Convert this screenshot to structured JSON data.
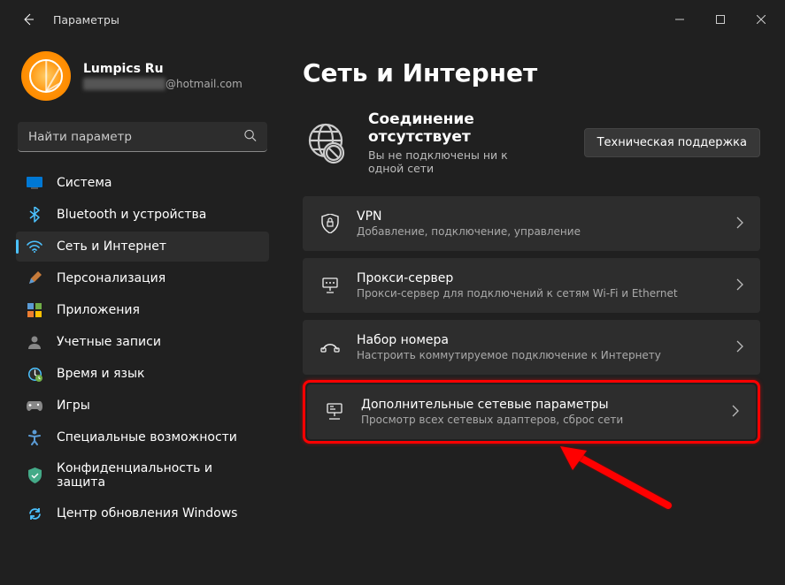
{
  "window": {
    "title": "Параметры"
  },
  "profile": {
    "name": "Lumpics Ru",
    "email_suffix": "@hotmail.com"
  },
  "search": {
    "placeholder": "Найти параметр"
  },
  "sidebar": {
    "items": [
      {
        "label": "Система",
        "icon": "system"
      },
      {
        "label": "Bluetooth и устройства",
        "icon": "bluetooth"
      },
      {
        "label": "Сеть и Интернет",
        "icon": "network",
        "active": true
      },
      {
        "label": "Персонализация",
        "icon": "personalize"
      },
      {
        "label": "Приложения",
        "icon": "apps"
      },
      {
        "label": "Учетные записи",
        "icon": "accounts"
      },
      {
        "label": "Время и язык",
        "icon": "time"
      },
      {
        "label": "Игры",
        "icon": "gaming"
      },
      {
        "label": "Специальные возможности",
        "icon": "accessibility"
      },
      {
        "label": "Конфиденциальность и защита",
        "icon": "privacy"
      },
      {
        "label": "Центр обновления Windows",
        "icon": "update"
      }
    ]
  },
  "page": {
    "title": "Сеть и Интернет",
    "status": {
      "title": "Соединение отсутствует",
      "subtitle": "Вы не подключены ни к одной сети",
      "support": "Техническая поддержка"
    },
    "rows": [
      {
        "title": "VPN",
        "subtitle": "Добавление, подключение, управление",
        "icon": "vpn"
      },
      {
        "title": "Прокси-сервер",
        "subtitle": "Прокси-сервер для подключений к сетям Wi-Fi и Ethernet",
        "icon": "proxy"
      },
      {
        "title": "Набор номера",
        "subtitle": "Настроить коммутируемое подключение к Интернету",
        "icon": "dialup"
      },
      {
        "title": "Дополнительные сетевые параметры",
        "subtitle": "Просмотр всех сетевых адаптеров, сброс сети",
        "icon": "advanced",
        "highlighted": true
      }
    ]
  }
}
